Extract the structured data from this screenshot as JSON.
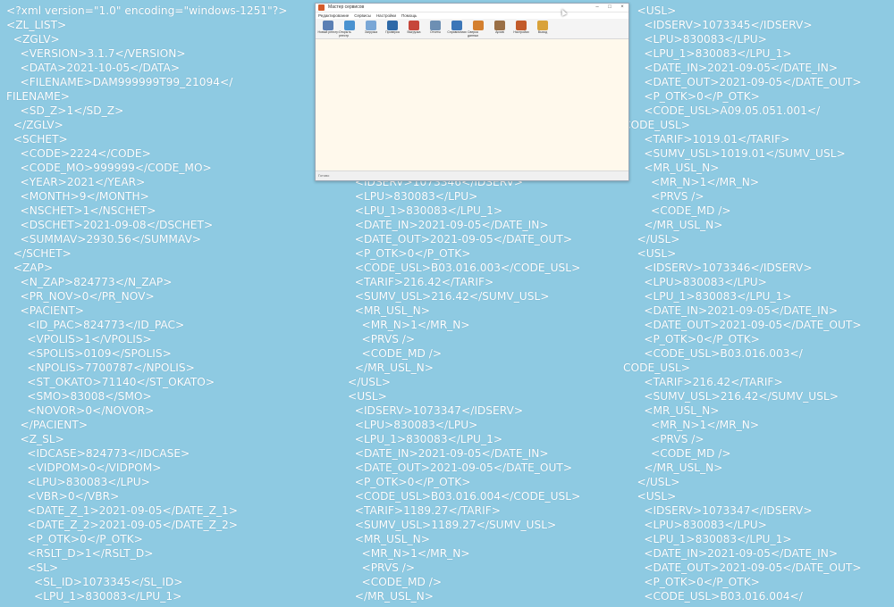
{
  "window": {
    "title": "Мастер сервисов",
    "menu": [
      "Редактирование",
      "Сервисы",
      "Настройки",
      "Помощь"
    ],
    "toolbar": [
      {
        "label": "Новый реестр",
        "color": "#5b7fb4"
      },
      {
        "label": "Открыть реестр",
        "color": "#4a92d0"
      },
      {
        "label": "Загрузка",
        "color": "#7aa7d6"
      },
      {
        "label": "Проверка",
        "color": "#2f6aa8"
      },
      {
        "label": "Выгрузка",
        "color": "#c6463a"
      },
      {
        "label": "Отчеты",
        "color": "#6d8fb3"
      },
      {
        "label": "Справочники",
        "color": "#3c76b8"
      },
      {
        "label": "Сверка данных",
        "color": "#d47f2e"
      },
      {
        "label": "Архив",
        "color": "#9a6f45"
      },
      {
        "label": "Настройки",
        "color": "#c25b2a"
      },
      {
        "label": "Выход",
        "color": "#d9a23a"
      }
    ],
    "status": "Готово"
  },
  "xml": {
    "col1": [
      "<?xml version=\"1.0\" encoding=\"windows-1251\"?>",
      "<ZL_LIST>",
      "  <ZGLV>",
      "    <VERSION>3.1.7</VERSION>",
      "    <DATA>2021-10-05</DATA>",
      "    <FILENAME>DAM999999T99_21094</",
      "FILENAME>",
      "    <SD_Z>1</SD_Z>",
      "  </ZGLV>",
      "  <SCHET>",
      "    <CODE>2224</CODE>",
      "    <CODE_MO>999999</CODE_MO>",
      "    <YEAR>2021</YEAR>",
      "    <MONTH>9</MONTH>",
      "    <NSCHET>1</NSCHET>",
      "    <DSCHET>2021-09-08</DSCHET>",
      "    <SUMMAV>2930.56</SUMMAV>",
      "  </SCHET>",
      "  <ZAP>",
      "    <N_ZAP>824773</N_ZAP>",
      "    <PR_NOV>0</PR_NOV>",
      "    <PACIENT>",
      "      <ID_PAC>824773</ID_PAC>",
      "      <VPOLIS>1</VPOLIS>",
      "      <SPOLIS>0109</SPOLIS>",
      "      <NPOLIS>7700787</NPOLIS>",
      "      <ST_OKATO>71140</ST_OKATO>",
      "      <SMO>83008</SMO>",
      "      <NOVOR>0</NOVOR>",
      "    </PACIENT>",
      "    <Z_SL>",
      "      <IDCASE>824773</IDCASE>",
      "      <VIDPOM>0</VIDPOM>",
      "      <LPU>830083</LPU>",
      "      <VBR>0</VBR>",
      "      <DATE_Z_1>2021-09-05</DATE_Z_1>",
      "      <DATE_Z_2>2021-09-05</DATE_Z_2>",
      "      <P_OTK>0</P_OTK>",
      "      <RSLT_D>1</RSLT_D>",
      "      <SL>",
      "        <SL_ID>1073345</SL_ID>",
      "        <LPU_1>830083</LPU_1>"
    ],
    "col2": [
      "",
      "",
      "",
      "",
      "",
      "",
      "",
      "",
      "",
      "",
      "",
      "",
      "  <IDSERV>1073346</IDSERV>",
      "  <LPU>830083</LPU>",
      "  <LPU_1>830083</LPU_1>",
      "  <DATE_IN>2021-09-05</DATE_IN>",
      "  <DATE_OUT>2021-09-05</DATE_OUT>",
      "  <P_OTK>0</P_OTK>",
      "  <CODE_USL>B03.016.003</CODE_USL>",
      "  <TARIF>216.42</TARIF>",
      "  <SUMV_USL>216.42</SUMV_USL>",
      "  <MR_USL_N>",
      "    <MR_N>1</MR_N>",
      "    <PRVS />",
      "    <CODE_MD />",
      "  </MR_USL_N>",
      "</USL>",
      "<USL>",
      "  <IDSERV>1073347</IDSERV>",
      "  <LPU>830083</LPU>",
      "  <LPU_1>830083</LPU_1>",
      "  <DATE_IN>2021-09-05</DATE_IN>",
      "  <DATE_OUT>2021-09-05</DATE_OUT>",
      "  <P_OTK>0</P_OTK>",
      "  <CODE_USL>B03.016.004</CODE_USL>",
      "  <TARIF>1189.27</TARIF>",
      "  <SUMV_USL>1189.27</SUMV_USL>",
      "  <MR_USL_N>",
      "    <MR_N>1</MR_N>",
      "    <PRVS />",
      "    <CODE_MD />",
      "  </MR_USL_N>"
    ],
    "col3": [
      "    <USL>",
      "      <IDSERV>1073345</IDSERV>",
      "      <LPU>830083</LPU>",
      "      <LPU_1>830083</LPU_1>",
      "      <DATE_IN>2021-09-05</DATE_IN>",
      "      <DATE_OUT>2021-09-05</DATE_OUT>",
      "      <P_OTK>0</P_OTK>",
      "      <CODE_USL>A09.05.051.001</",
      "CODE_USL>",
      "      <TARIF>1019.01</TARIF>",
      "      <SUMV_USL>1019.01</SUMV_USL>",
      "      <MR_USL_N>",
      "        <MR_N>1</MR_N>",
      "        <PRVS />",
      "        <CODE_MD />",
      "      </MR_USL_N>",
      "    </USL>",
      "    <USL>",
      "      <IDSERV>1073346</IDSERV>",
      "      <LPU>830083</LPU>",
      "      <LPU_1>830083</LPU_1>",
      "      <DATE_IN>2021-09-05</DATE_IN>",
      "      <DATE_OUT>2021-09-05</DATE_OUT>",
      "      <P_OTK>0</P_OTK>",
      "      <CODE_USL>B03.016.003</",
      "CODE_USL>",
      "      <TARIF>216.42</TARIF>",
      "      <SUMV_USL>216.42</SUMV_USL>",
      "      <MR_USL_N>",
      "        <MR_N>1</MR_N>",
      "        <PRVS />",
      "        <CODE_MD />",
      "      </MR_USL_N>",
      "    </USL>",
      "    <USL>",
      "      <IDSERV>1073347</IDSERV>",
      "      <LPU>830083</LPU>",
      "      <LPU_1>830083</LPU_1>",
      "      <DATE_IN>2021-09-05</DATE_IN>",
      "      <DATE_OUT>2021-09-05</DATE_OUT>",
      "      <P_OTK>0</P_OTK>",
      "      <CODE_USL>B03.016.004</"
    ]
  }
}
